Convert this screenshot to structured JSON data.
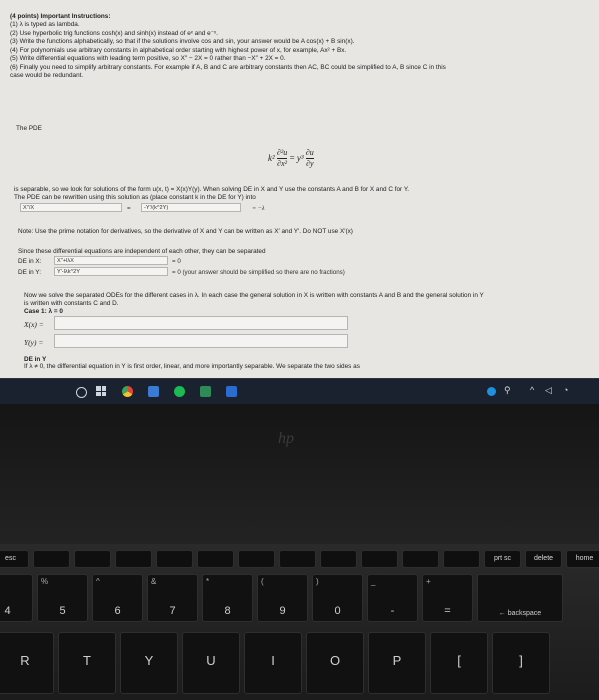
{
  "header": {
    "points": "(4 points) Important Instructions:",
    "rules": [
      "(1) λ is typed as lambda.",
      "(2) Use hyperbolic trig functions cosh(x) and sinh(x) instead of eˣ and e⁻ˣ.",
      "(3) Write the functions alphabetically, so that if the solutions involve cos and sin, your answer would be A cos(x) + B sin(x).",
      "(4) For polynomials use arbitrary constants in alphabetical order starting with highest power of x, for example, Ax² + Bx.",
      "(5) Write differential equations with leading term positive, so X″ − 2X = 0 rather than −X″ + 2X = 0.",
      "(6) Finally you need to simplify arbitrary constants. For example if A, B and C are arbitrary constants then AC, BC could be simplified to A, B since C in this",
      "case would be redundant."
    ]
  },
  "pde": {
    "heading": "The PDE",
    "lhs_coef": "k²",
    "lhs_num": "∂²u",
    "lhs_den": "∂x²",
    "equals": "=",
    "rhs_coef": "y³",
    "rhs_num": "∂u",
    "rhs_den": "∂y",
    "separable_text": "is separable, so we look for solutions of the form u(x, t) = X(x)Y(y). When solving DE in X and Y use the constants A and B for X and C for Y.",
    "rewrite_text": "The PDE can be rewritten using this solution as (place constant k in the DE for Y) into",
    "field_left_value": "X''/X",
    "eq_sign": "=",
    "field_right_value": "-Y'/(k^2Y)",
    "eq_lambda": "= −λ"
  },
  "note": {
    "text": "Note: Use the prime notation for derivatives, so the derivative of X and Y can be written as X′ and Y′. Do NOT use X′(x)",
    "independent_text": "Since these differential equations are independent of each other, they can be separated",
    "de_x_label": "DE in X:",
    "de_x_value": "X''+lλX",
    "de_x_rhs": "= 0",
    "de_y_label": "DE in Y:",
    "de_y_value": "Y'-lλk^2Y",
    "de_y_rhs": "= 0 (your answer should be simplified so there are no fractions)"
  },
  "solve": {
    "text1": "Now we solve the separated ODEs for the different cases in λ. In each case the general solution in X is written with constants A and B and the general solution in Y",
    "text2": "is written with constants C and D.",
    "case1": "Case 1: λ = 0",
    "x_label": "X(x) =",
    "x_value": "",
    "y_label": "Y(y) =",
    "y_value": "",
    "de_in_y": "DE in Y",
    "last_line": "If λ ≠ 0, the differential equation in Y is first order, linear, and more importantly separable. We separate the two sides as"
  },
  "taskbar": {
    "icons": [
      "windows-icon",
      "task-view-icon",
      "chrome-icon",
      "photos-icon",
      "spotify-icon",
      "files-icon",
      "mail-icon"
    ],
    "tray": [
      "network-icon",
      "people-icon",
      "chevron-up-icon",
      "volume-icon",
      "wifi-icon"
    ]
  },
  "laptop": {
    "logo": "hp"
  },
  "keyboard": {
    "fkeys": [
      "esc",
      "",
      "",
      "",
      "",
      "",
      "",
      "",
      "",
      "",
      "",
      "",
      "prt sc",
      "delete",
      "home"
    ],
    "number_row": [
      {
        "main": "4",
        "alt": "$"
      },
      {
        "main": "5",
        "alt": "%"
      },
      {
        "main": "6",
        "alt": "^"
      },
      {
        "main": "7",
        "alt": "&"
      },
      {
        "main": "8",
        "alt": "*"
      },
      {
        "main": "9",
        "alt": "("
      },
      {
        "main": "0",
        "alt": ")"
      },
      {
        "main": "-",
        "alt": "_"
      },
      {
        "main": "=",
        "alt": "+"
      },
      {
        "main": "← backspace",
        "alt": ""
      }
    ],
    "letter_row": [
      "R",
      "T",
      "Y",
      "U",
      "I",
      "O",
      "P",
      "[",
      "]"
    ]
  },
  "colors": {
    "screen_bg": "#e8e6e2",
    "text": "#1e1e22",
    "taskbar": "#1a2230",
    "key": "#111112"
  }
}
